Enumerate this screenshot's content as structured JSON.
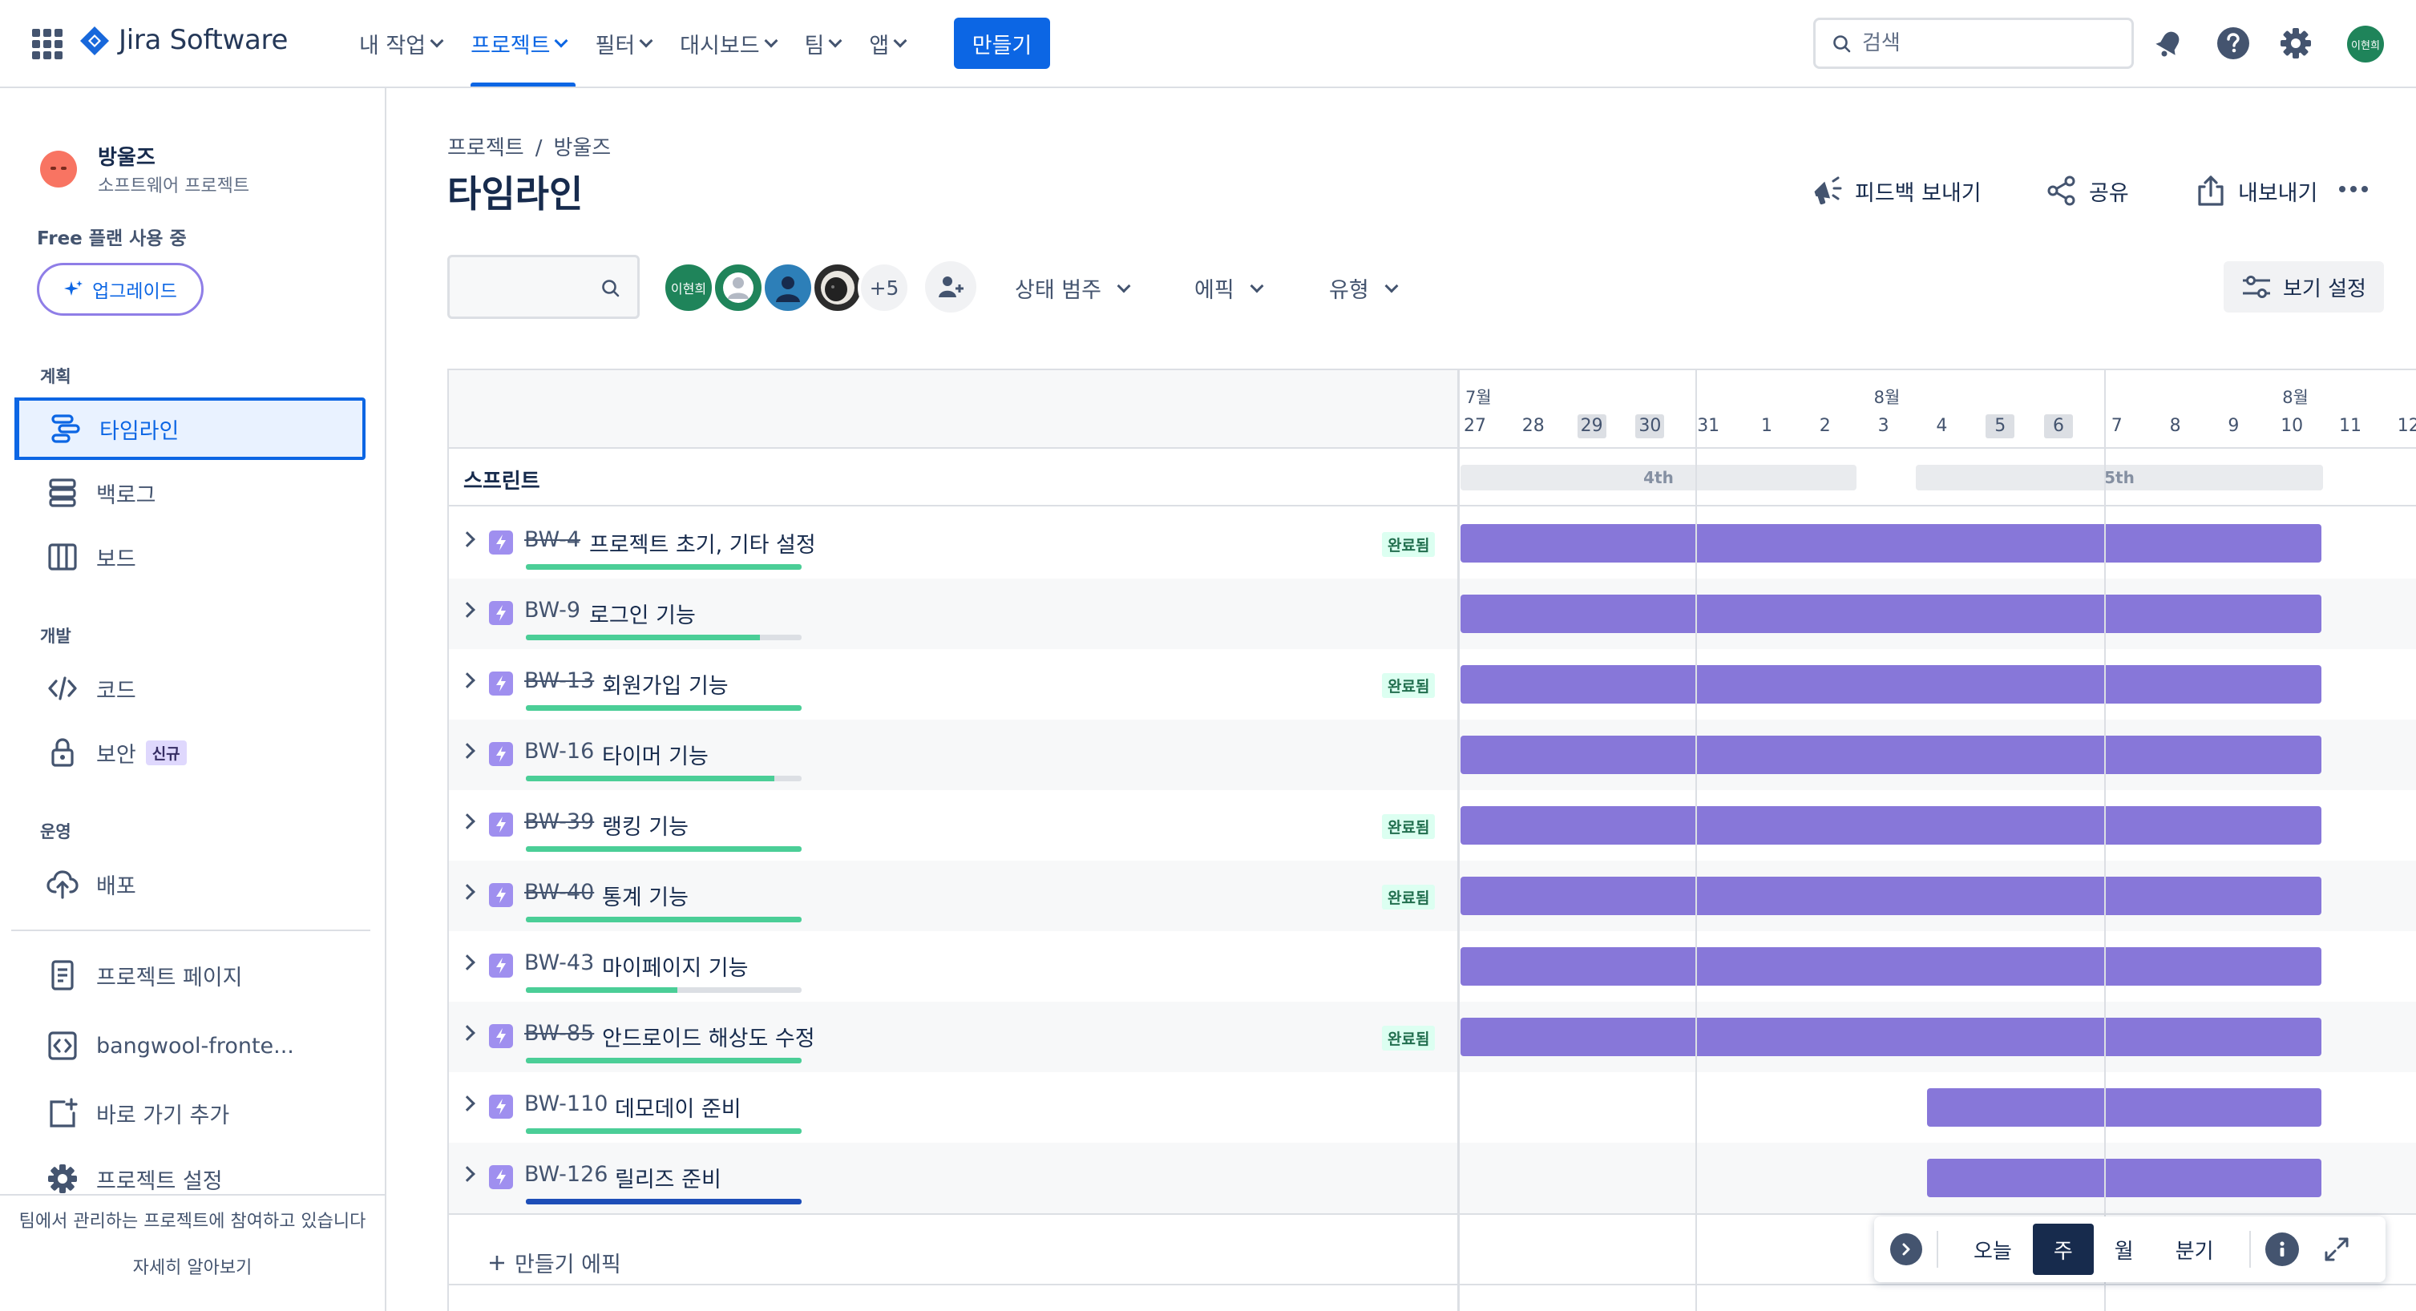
{
  "topnav": {
    "app_name": "Jira Software",
    "links": [
      "내 작업",
      "프로젝트",
      "필터",
      "대시보드",
      "팀",
      "앱"
    ],
    "active_link": "프로젝트",
    "create_label": "만들기",
    "search_placeholder": "검색",
    "user_initials": "이현희"
  },
  "sidebar": {
    "project_name": "방울즈",
    "project_type": "소프트웨어 프로젝트",
    "plan_label": "Free 플랜 사용 중",
    "upgrade_label": "업그레이드",
    "section_planning": "계획",
    "item_timeline": "타임라인",
    "item_backlog": "백로그",
    "item_board": "보드",
    "section_dev": "개발",
    "item_code": "코드",
    "item_security": "보안",
    "new_badge": "신규",
    "section_ops": "운영",
    "item_deploy": "배포",
    "item_project_pages": "프로젝트 페이지",
    "item_repo": "bangwool-fronte...",
    "item_add_shortcut": "바로 가기 추가",
    "item_project_settings": "프로젝트 설정",
    "footer_text": "팀에서 관리하는 프로젝트에 참여하고 있습니다",
    "footer_link": "자세히 알아보기"
  },
  "header": {
    "breadcrumb_root": "프로젝트",
    "breadcrumb_sep": "/",
    "breadcrumb_project": "방울즈",
    "title": "타임라인",
    "feedback_label": "피드백 보내기",
    "share_label": "공유",
    "export_label": "내보내기"
  },
  "filters": {
    "avatars": [
      {
        "initials": "이현희",
        "color": "#1F845A"
      },
      {
        "initials": "",
        "color": "#1F845A"
      },
      {
        "initials": "",
        "color": "#2D7FB8"
      },
      {
        "initials": "",
        "color": "#2C2C2C"
      }
    ],
    "more_count": "+5",
    "status_category": "상태 범주",
    "epic": "에픽",
    "type": "유형",
    "view_settings": "보기 설정"
  },
  "timeline": {
    "months": [
      "7월",
      "8월",
      "8월"
    ],
    "days": [
      "27",
      "28",
      "29",
      "30",
      "31",
      "1",
      "2",
      "3",
      "4",
      "5",
      "6",
      "7",
      "8",
      "9",
      "10",
      "11",
      "12"
    ],
    "weekend_days": [
      "29",
      "30",
      "5",
      "6"
    ],
    "sprint_label": "스프린트",
    "sprints": [
      "4th",
      "5th"
    ],
    "done_label": "완료됨",
    "create_epic_label": "만들기 에픽",
    "epics": [
      {
        "key": "BW-4",
        "title": "프로젝트 초기, 기타 설정",
        "done": true,
        "progress": 1.0,
        "start_day": "27",
        "end_day": "11"
      },
      {
        "key": "BW-9",
        "title": "로그인 기능",
        "done": false,
        "progress": 0.85,
        "start_day": "27",
        "end_day": "11"
      },
      {
        "key": "BW-13",
        "title": "회원가입 기능",
        "done": true,
        "progress": 1.0,
        "start_day": "27",
        "end_day": "11"
      },
      {
        "key": "BW-16",
        "title": "타이머 기능",
        "done": false,
        "progress": 0.9,
        "start_day": "27",
        "end_day": "11"
      },
      {
        "key": "BW-39",
        "title": "랭킹 기능",
        "done": true,
        "progress": 1.0,
        "start_day": "27",
        "end_day": "11"
      },
      {
        "key": "BW-40",
        "title": "통계 기능",
        "done": true,
        "progress": 1.0,
        "start_day": "27",
        "end_day": "11"
      },
      {
        "key": "BW-43",
        "title": "마이페이지 기능",
        "done": false,
        "progress": 0.55,
        "start_day": "27",
        "end_day": "11"
      },
      {
        "key": "BW-85",
        "title": "안드로이드 해상도 수정",
        "done": true,
        "progress": 1.0,
        "start_day": "27",
        "end_day": "11"
      },
      {
        "key": "BW-110",
        "title": "데모데이 준비",
        "done": false,
        "progress": 1.0,
        "start_day": "4",
        "end_day": "11"
      },
      {
        "key": "BW-126",
        "title": "릴리즈 준비",
        "done": false,
        "progress": 1.0,
        "start_day": "4",
        "end_day": "11",
        "progress_color": "#1D4EB8"
      }
    ]
  },
  "zoom": {
    "today": "오늘",
    "week": "주",
    "month": "월",
    "quarter": "분기",
    "active": "주"
  }
}
